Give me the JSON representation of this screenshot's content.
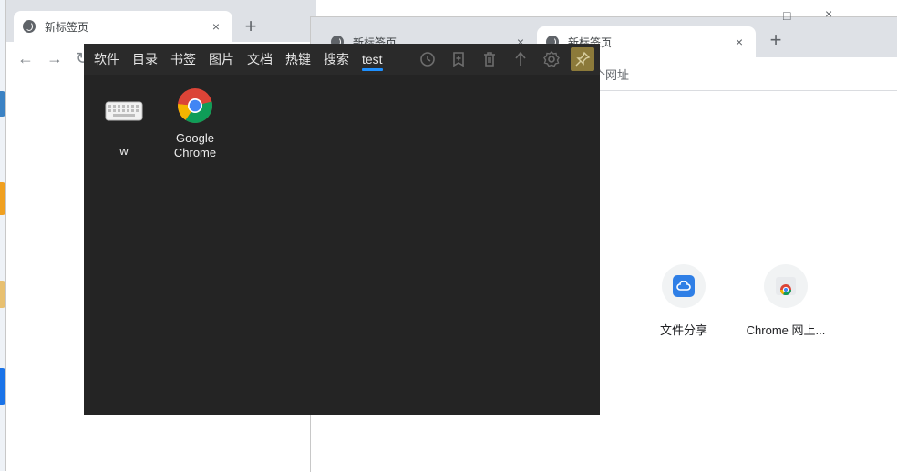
{
  "back_window": {
    "tab_title": "新标签页",
    "close_glyph": "×",
    "newtab_glyph": "+"
  },
  "right_window": {
    "tab_inactive_title": "新标签页",
    "tab_active_title": "新标签页",
    "close_glyph": "×",
    "newtab_glyph": "+",
    "omnibox_placeholder_fragment": "个网址",
    "shortcuts": [
      {
        "label": "文件分享",
        "icon": "cloud-share-icon"
      },
      {
        "label": "Chrome 网上...",
        "icon": "chrome-webstore-icon"
      }
    ]
  },
  "launcher": {
    "menu": [
      {
        "label": "软件"
      },
      {
        "label": "目录"
      },
      {
        "label": "书签"
      },
      {
        "label": "图片"
      },
      {
        "label": "文档"
      },
      {
        "label": "热键"
      },
      {
        "label": "搜索"
      },
      {
        "label": "test",
        "active": true
      }
    ],
    "toolbar_icons": [
      "history-icon",
      "add-bookmark-icon",
      "trash-icon",
      "up-arrow-icon",
      "settings-icon",
      "pin-icon"
    ],
    "items": [
      {
        "label": "w",
        "icon": "keyboard-icon"
      },
      {
        "label_line1": "Google",
        "label_line2": "Chrome",
        "icon": "chrome-icon"
      }
    ],
    "accent_color": "#1e90ff",
    "background_color": "#242424"
  }
}
